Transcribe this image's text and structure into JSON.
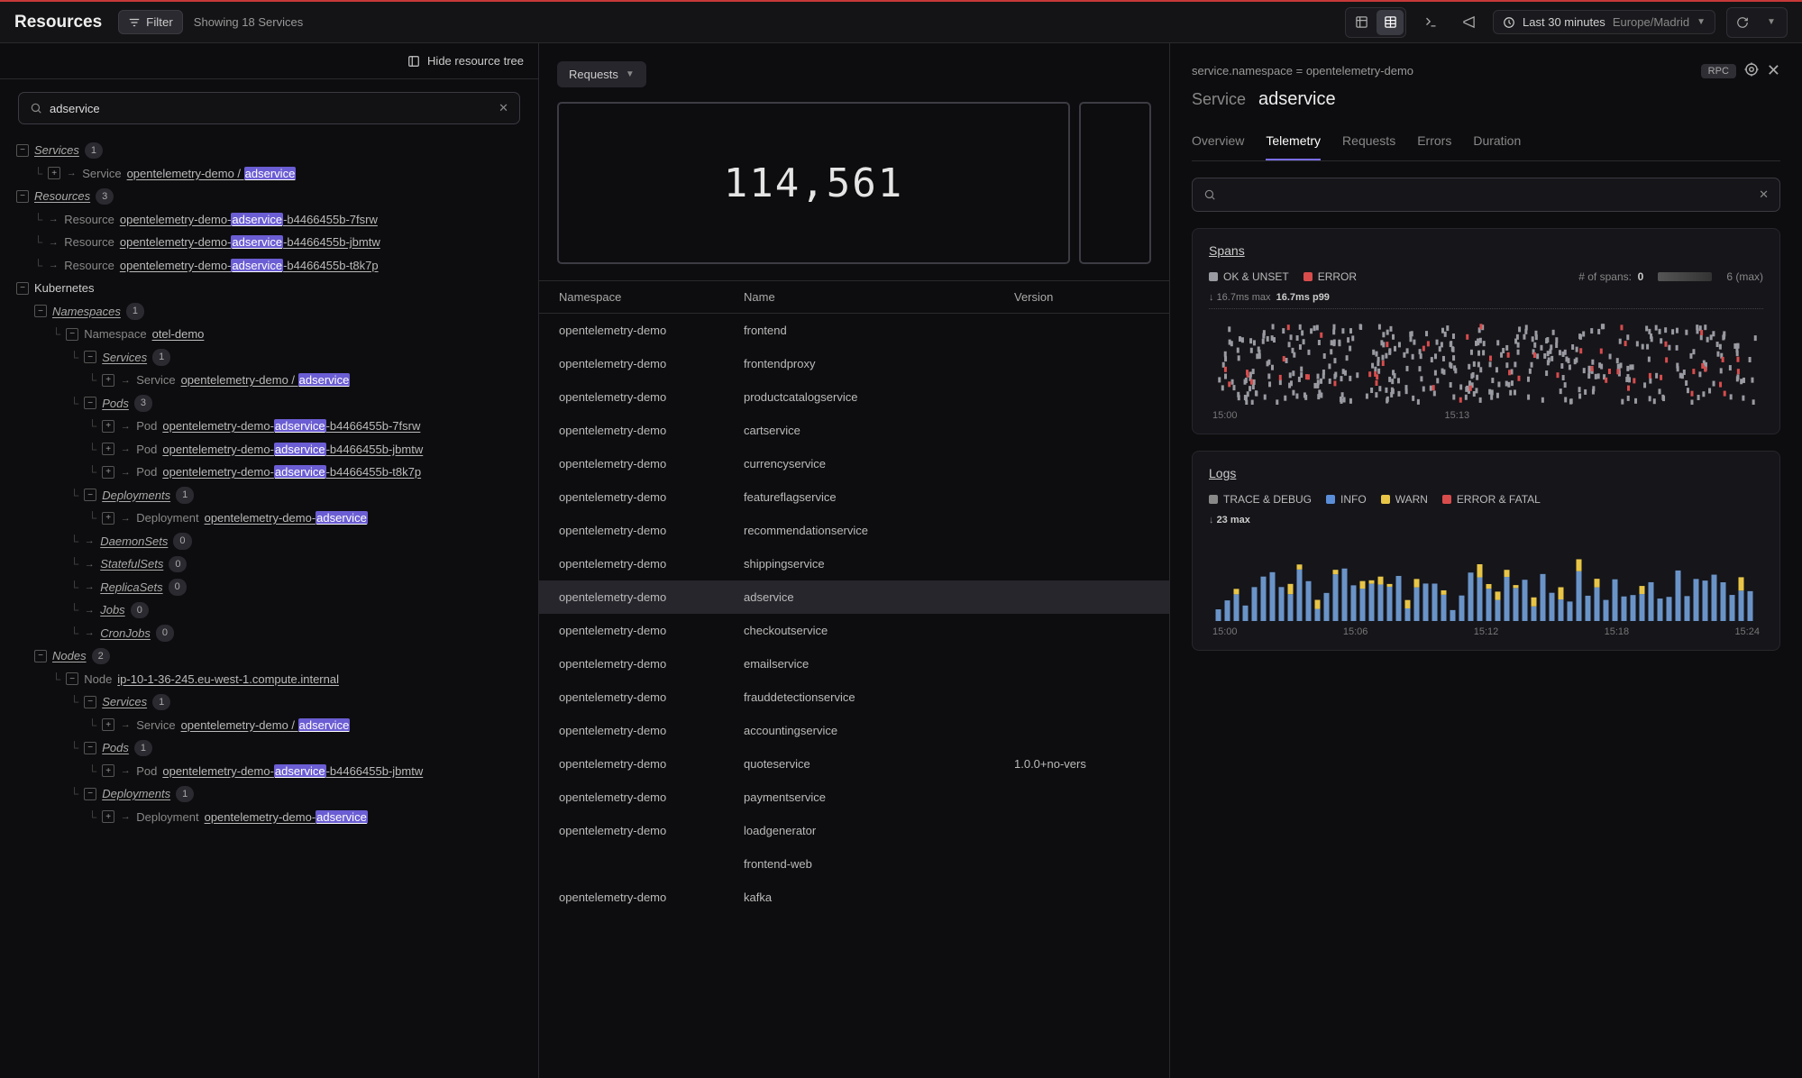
{
  "header": {
    "title": "Resources",
    "filter_label": "Filter",
    "showing": "Showing 18 Services",
    "time_range": "Last 30 minutes",
    "timezone": "Europe/Madrid"
  },
  "tree_panel": {
    "hide_label": "Hide resource tree",
    "search_value": "adservice",
    "sections": {
      "services": {
        "label": "Services",
        "count": 1
      },
      "resources": {
        "label": "Resources",
        "count": 3
      },
      "kubernetes": {
        "label": "Kubernetes"
      },
      "namespaces": {
        "label": "Namespaces",
        "count": 1
      },
      "nodes": {
        "label": "Nodes",
        "count": 2
      }
    },
    "service_item": {
      "type": "Service",
      "prefix": "opentelemetry-demo / ",
      "hl": "adservice"
    },
    "resource_items": [
      {
        "type": "Resource",
        "prefix": "opentelemetry-demo-",
        "hl": "adservice",
        "suffix": "-b4466455b-7fsrw"
      },
      {
        "type": "Resource",
        "prefix": "opentelemetry-demo-",
        "hl": "adservice",
        "suffix": "-b4466455b-jbmtw"
      },
      {
        "type": "Resource",
        "prefix": "opentelemetry-demo-",
        "hl": "adservice",
        "suffix": "-b4466455b-t8k7p"
      }
    ],
    "ns_item": {
      "type": "Namespace",
      "name": "otel-demo"
    },
    "ns_services": {
      "label": "Services",
      "count": 1,
      "item": {
        "type": "Service",
        "prefix": "opentelemetry-demo / ",
        "hl": "adservice"
      }
    },
    "ns_pods": {
      "label": "Pods",
      "count": 3,
      "items": [
        {
          "type": "Pod",
          "prefix": "opentelemetry-demo-",
          "hl": "adservice",
          "suffix": "-b4466455b-7fsrw"
        },
        {
          "type": "Pod",
          "prefix": "opentelemetry-demo-",
          "hl": "adservice",
          "suffix": "-b4466455b-jbmtw"
        },
        {
          "type": "Pod",
          "prefix": "opentelemetry-demo-",
          "hl": "adservice",
          "suffix": "-b4466455b-t8k7p"
        }
      ]
    },
    "ns_deployments": {
      "label": "Deployments",
      "count": 1,
      "item": {
        "type": "Deployment",
        "prefix": "opentelemetry-demo-",
        "hl": "adservice"
      }
    },
    "empty_cats": [
      {
        "label": "DaemonSets",
        "count": 0
      },
      {
        "label": "StatefulSets",
        "count": 0
      },
      {
        "label": "ReplicaSets",
        "count": 0
      },
      {
        "label": "Jobs",
        "count": 0
      },
      {
        "label": "CronJobs",
        "count": 0
      }
    ],
    "node_item": {
      "type": "Node",
      "name": "ip-10-1-36-245.eu-west-1.compute.internal"
    },
    "node_services": {
      "label": "Services",
      "count": 1,
      "item": {
        "type": "Service",
        "prefix": "opentelemetry-demo / ",
        "hl": "adservice"
      }
    },
    "node_pods": {
      "label": "Pods",
      "count": 1,
      "item": {
        "type": "Pod",
        "prefix": "opentelemetry-demo-",
        "hl": "adservice",
        "suffix": "-b4466455b-jbmtw"
      }
    },
    "node_deployments": {
      "label": "Deployments",
      "count": 1,
      "item": {
        "type": "Deployment",
        "prefix": "opentelemetry-demo-",
        "hl": "adservice"
      }
    }
  },
  "center": {
    "dropdown": "Requests",
    "big_number": "114,561",
    "table": {
      "headers": {
        "ns": "Namespace",
        "name": "Name",
        "version": "Version"
      },
      "rows": [
        {
          "ns": "opentelemetry-demo",
          "name": "frontend",
          "version": ""
        },
        {
          "ns": "opentelemetry-demo",
          "name": "frontendproxy",
          "version": ""
        },
        {
          "ns": "opentelemetry-demo",
          "name": "productcatalogservice",
          "version": ""
        },
        {
          "ns": "opentelemetry-demo",
          "name": "cartservice",
          "version": ""
        },
        {
          "ns": "opentelemetry-demo",
          "name": "currencyservice",
          "version": ""
        },
        {
          "ns": "opentelemetry-demo",
          "name": "featureflagservice",
          "version": ""
        },
        {
          "ns": "opentelemetry-demo",
          "name": "recommendationservice",
          "version": ""
        },
        {
          "ns": "opentelemetry-demo",
          "name": "shippingservice",
          "version": ""
        },
        {
          "ns": "opentelemetry-demo",
          "name": "adservice",
          "version": "",
          "selected": true
        },
        {
          "ns": "opentelemetry-demo",
          "name": "checkoutservice",
          "version": ""
        },
        {
          "ns": "opentelemetry-demo",
          "name": "emailservice",
          "version": ""
        },
        {
          "ns": "opentelemetry-demo",
          "name": "frauddetectionservice",
          "version": ""
        },
        {
          "ns": "opentelemetry-demo",
          "name": "accountingservice",
          "version": ""
        },
        {
          "ns": "opentelemetry-demo",
          "name": "quoteservice",
          "version": "1.0.0+no-vers"
        },
        {
          "ns": "opentelemetry-demo",
          "name": "paymentservice",
          "version": ""
        },
        {
          "ns": "opentelemetry-demo",
          "name": "loadgenerator",
          "version": ""
        },
        {
          "ns": "",
          "name": "frontend-web",
          "version": ""
        },
        {
          "ns": "opentelemetry-demo",
          "name": "kafka",
          "version": ""
        }
      ]
    }
  },
  "detail": {
    "ns_line": "service.namespace = opentelemetry-demo",
    "badge": "RPC",
    "label": "Service",
    "name": "adservice",
    "tabs": [
      "Overview",
      "Telemetry",
      "Requests",
      "Errors",
      "Duration"
    ],
    "active_tab": "Telemetry",
    "spans": {
      "title": "Spans",
      "legend": {
        "ok": "OK & UNSET",
        "err": "ERROR"
      },
      "stat_label": "# of spans:",
      "stat_val": "0",
      "stat_max": "6 (max)",
      "sub1": "16.7ms max",
      "sub2": "16.7ms p99",
      "xticks": [
        "15:00",
        "15:13"
      ]
    },
    "logs": {
      "title": "Logs",
      "legend": {
        "trace": "TRACE & DEBUG",
        "info": "INFO",
        "warn": "WARN",
        "err": "ERROR & FATAL"
      },
      "sub": "23 max",
      "xticks": [
        "15:00",
        "15:06",
        "15:12",
        "15:18",
        "15:24"
      ]
    }
  },
  "chart_data": [
    {
      "type": "scatter",
      "title": "Spans",
      "x_range": [
        "15:00",
        "15:28"
      ],
      "series": [
        {
          "name": "OK & UNSET",
          "approx_count": 420
        },
        {
          "name": "ERROR",
          "approx_count": 55
        }
      ],
      "y_max_spans": 6,
      "ymax_latency_ms": 16.7
    },
    {
      "type": "bar",
      "title": "Logs",
      "x_range": [
        "15:00",
        "15:28"
      ],
      "y_max": 23,
      "categories_minutes": 60,
      "series": [
        {
          "name": "INFO",
          "typical_value": 12
        },
        {
          "name": "WARN",
          "typical_value": 3
        },
        {
          "name": "TRACE & DEBUG",
          "typical_value": 1
        },
        {
          "name": "ERROR & FATAL",
          "typical_value": 0
        }
      ]
    }
  ]
}
